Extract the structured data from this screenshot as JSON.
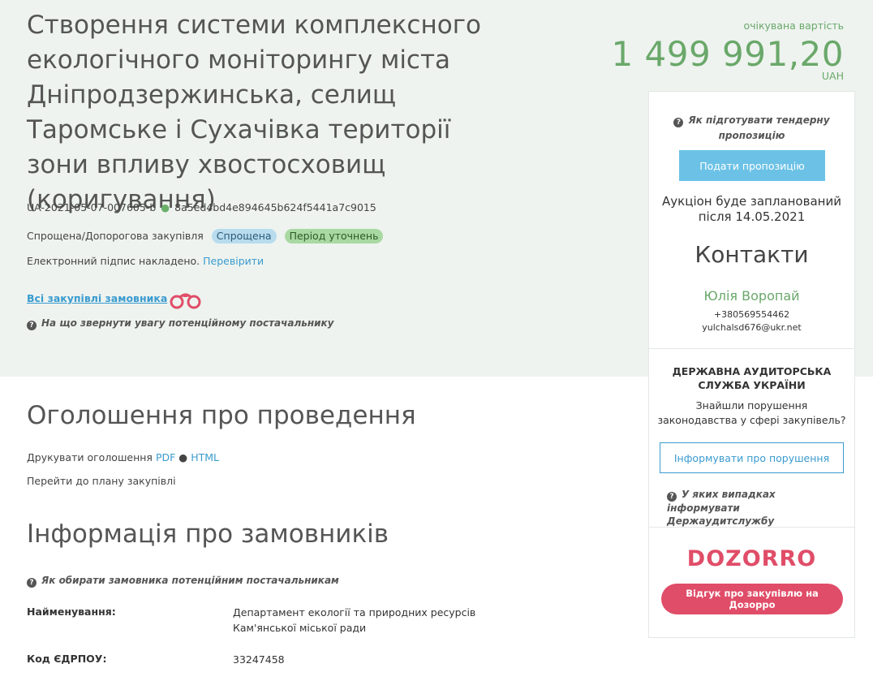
{
  "tender": {
    "title": "Створення системи комплексного екологічного моніторингу міста Дніпродзержинська, селищ Таромське і Сухачівка території зони впливу хвостосховищ (коригування)",
    "id": "UA-2021-05-07-007605-b",
    "hash": "8a5ed4bd4e894645b624f5441a7c9015",
    "procedure": "Спрощена/Допорогова закупівля",
    "badge_simplified": "Спрощена",
    "badge_period": "Період уточнень",
    "signature_text": "Електронний підпис накладено.",
    "signature_link": "Перевірити",
    "all_purchases": "Всі закупівлі замовника",
    "attention_help": "На що звернути увагу потенційному постачальнику"
  },
  "price": {
    "label": "очікувана вартість",
    "value": "1 499 991,20",
    "currency": "UAH"
  },
  "side": {
    "propose_help": "Як підготувати тендерну пропозицію",
    "propose_button": "Подати пропозицію",
    "auction_text": "Аукціон буде запланований після 14.05.2021",
    "contacts_title": "Контакти",
    "contact_name": "Юлія Воропай",
    "contact_phone": "+380569554462",
    "contact_email": "yulchalsd676@ukr.net",
    "audit_title": "ДЕРЖАВНА АУДИТОРСЬКА СЛУЖБА УКРАЇНИ",
    "audit_text": "Знайшли порушення законодавства у сфері закупівель?",
    "audit_button": "Інформувати про порушення",
    "audit_help": "У яких випадках інформувати Держаудитслужбу",
    "dozorro_logo": "DOZORRO",
    "dozorro_button": "Відгук про закупівлю на Дозорро"
  },
  "announcement": {
    "heading": "Оголошення про проведення",
    "print_label": "Друкувати оголошення",
    "pdf": "PDF",
    "html": "HTML",
    "plan_link": "Перейти до плану закупівлі"
  },
  "customers": {
    "heading": "Інформація про замовників",
    "help": "Як обирати замовника потенційним постачальникам",
    "name_label": "Найменування:",
    "name_value_1": "Департамент екології та природних ресурсів",
    "name_value_2": "Кам'янської міської ради",
    "code_label": "Код ЄДРПОУ:",
    "code_value": "33247458"
  },
  "colors": {
    "band_bg": "#eef3ef",
    "price_green": "#6aa86a",
    "link_blue": "#3a9bcf",
    "propose_blue": "#6cc2e6",
    "dozorro_red": "#e04d68"
  }
}
